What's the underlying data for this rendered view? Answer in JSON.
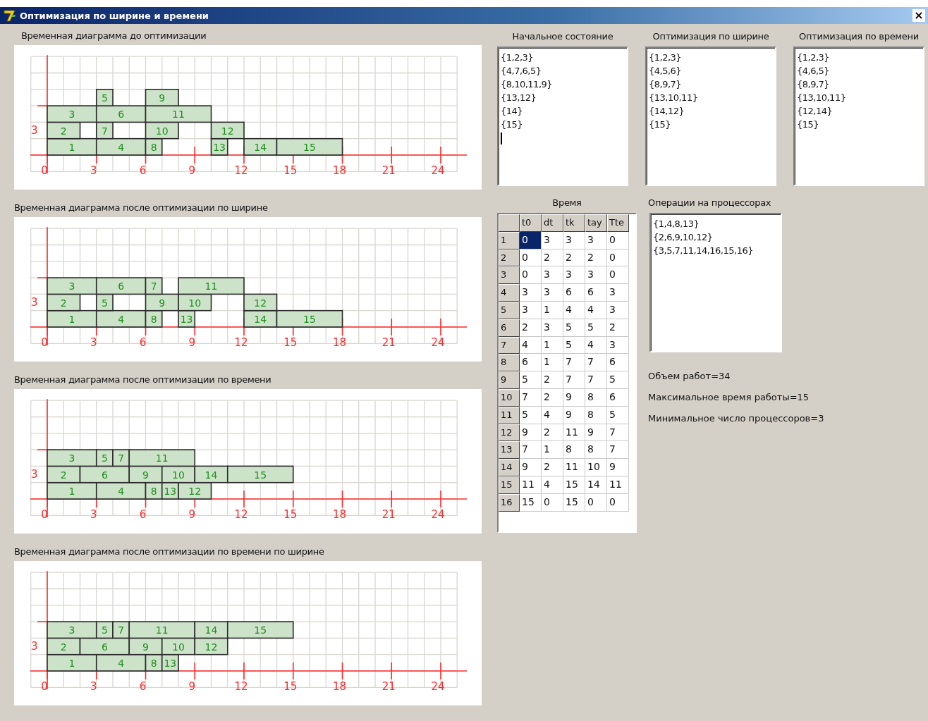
{
  "window": {
    "title": "Оптимизация по ширине и времени",
    "close": "×"
  },
  "charts": [
    {
      "title": "Временная диаграмма до оптимизации",
      "lane_label": "3",
      "time_labels": [
        "0",
        "3",
        "6",
        "9",
        "12",
        "15",
        "18",
        "21",
        "24"
      ],
      "tasks": [
        "1",
        "4",
        "8",
        "13",
        "14",
        "15",
        "2",
        "7",
        "10",
        "12",
        "3",
        "6",
        "11",
        "5",
        "9"
      ]
    },
    {
      "title": "Временная диаграмма после оптимизации по ширине",
      "lane_label": "3",
      "time_labels": [
        "0",
        "3",
        "6",
        "9",
        "12",
        "15",
        "18",
        "21",
        "24"
      ],
      "tasks": [
        "1",
        "4",
        "8",
        "13",
        "14",
        "15",
        "2",
        "5",
        "9",
        "10",
        "12",
        "3",
        "6",
        "7",
        "11"
      ]
    },
    {
      "title": "Временная диаграмма после оптимизации по времени",
      "lane_label": "3",
      "time_labels": [
        "0",
        "3",
        "6",
        "9",
        "12",
        "15",
        "18",
        "21",
        "24"
      ],
      "tasks": [
        "1",
        "4",
        "8",
        "13",
        "12",
        "2",
        "6",
        "9",
        "10",
        "14",
        "15",
        "3",
        "5",
        "7",
        "11"
      ]
    },
    {
      "title": "Временная диаграмма после оптимизации по времени по ширине",
      "lane_label": "3",
      "time_labels": [
        "0",
        "3",
        "6",
        "9",
        "12",
        "15",
        "18",
        "21",
        "24"
      ],
      "tasks": [
        "1",
        "4",
        "8",
        "13",
        "2",
        "6",
        "9",
        "10",
        "12",
        "3",
        "5",
        "7",
        "11",
        "14",
        "15"
      ]
    }
  ],
  "lists": [
    {
      "title": "Начальное состояние",
      "cursor": true,
      "lines": [
        "{1,2,3}",
        "{4,7,6,5}",
        "{8,10,11,9}",
        "{13,12}",
        "{14}",
        "{15}"
      ]
    },
    {
      "title": "Оптимизация по ширине",
      "cursor": false,
      "lines": [
        "{1,2,3}",
        "{4,5,6}",
        "{8,9,7}",
        "{13,10,11}",
        "{14,12}",
        "{15}"
      ]
    },
    {
      "title": "Оптимизация по времени",
      "cursor": false,
      "lines": [
        "{1,2,3}",
        "{4,6,5}",
        "{8,9,7}",
        "{13,10,11}",
        "{12,14}",
        "{15}"
      ]
    }
  ],
  "time_table": {
    "title": "Время",
    "columns": [
      "t0",
      "dt",
      "tk",
      "tay",
      "Tte"
    ],
    "rows": [
      {
        "header": "1",
        "cells": [
          {
            "text": "0",
            "selected": true
          },
          {
            "text": "3",
            "selected": false
          },
          {
            "text": "3",
            "selected": false
          },
          {
            "text": "3",
            "selected": false
          },
          {
            "text": "0",
            "selected": false
          }
        ]
      },
      {
        "header": "2",
        "cells": [
          {
            "text": "0",
            "selected": false
          },
          {
            "text": "2",
            "selected": false
          },
          {
            "text": "2",
            "selected": false
          },
          {
            "text": "2",
            "selected": false
          },
          {
            "text": "0",
            "selected": false
          }
        ]
      },
      {
        "header": "3",
        "cells": [
          {
            "text": "0",
            "selected": false
          },
          {
            "text": "3",
            "selected": false
          },
          {
            "text": "3",
            "selected": false
          },
          {
            "text": "3",
            "selected": false
          },
          {
            "text": "0",
            "selected": false
          }
        ]
      },
      {
        "header": "4",
        "cells": [
          {
            "text": "3",
            "selected": false
          },
          {
            "text": "3",
            "selected": false
          },
          {
            "text": "6",
            "selected": false
          },
          {
            "text": "6",
            "selected": false
          },
          {
            "text": "3",
            "selected": false
          }
        ]
      },
      {
        "header": "5",
        "cells": [
          {
            "text": "3",
            "selected": false
          },
          {
            "text": "1",
            "selected": false
          },
          {
            "text": "4",
            "selected": false
          },
          {
            "text": "4",
            "selected": false
          },
          {
            "text": "3",
            "selected": false
          }
        ]
      },
      {
        "header": "6",
        "cells": [
          {
            "text": "2",
            "selected": false
          },
          {
            "text": "3",
            "selected": false
          },
          {
            "text": "5",
            "selected": false
          },
          {
            "text": "5",
            "selected": false
          },
          {
            "text": "2",
            "selected": false
          }
        ]
      },
      {
        "header": "7",
        "cells": [
          {
            "text": "4",
            "selected": false
          },
          {
            "text": "1",
            "selected": false
          },
          {
            "text": "5",
            "selected": false
          },
          {
            "text": "4",
            "selected": false
          },
          {
            "text": "3",
            "selected": false
          }
        ]
      },
      {
        "header": "8",
        "cells": [
          {
            "text": "6",
            "selected": false
          },
          {
            "text": "1",
            "selected": false
          },
          {
            "text": "7",
            "selected": false
          },
          {
            "text": "7",
            "selected": false
          },
          {
            "text": "6",
            "selected": false
          }
        ]
      },
      {
        "header": "9",
        "cells": [
          {
            "text": "5",
            "selected": false
          },
          {
            "text": "2",
            "selected": false
          },
          {
            "text": "7",
            "selected": false
          },
          {
            "text": "7",
            "selected": false
          },
          {
            "text": "5",
            "selected": false
          }
        ]
      },
      {
        "header": "10",
        "cells": [
          {
            "text": "7",
            "selected": false
          },
          {
            "text": "2",
            "selected": false
          },
          {
            "text": "9",
            "selected": false
          },
          {
            "text": "8",
            "selected": false
          },
          {
            "text": "6",
            "selected": false
          }
        ]
      },
      {
        "header": "11",
        "cells": [
          {
            "text": "5",
            "selected": false
          },
          {
            "text": "4",
            "selected": false
          },
          {
            "text": "9",
            "selected": false
          },
          {
            "text": "8",
            "selected": false
          },
          {
            "text": "5",
            "selected": false
          }
        ]
      },
      {
        "header": "12",
        "cells": [
          {
            "text": "9",
            "selected": false
          },
          {
            "text": "2",
            "selected": false
          },
          {
            "text": "11",
            "selected": false
          },
          {
            "text": "9",
            "selected": false
          },
          {
            "text": "7",
            "selected": false
          }
        ]
      },
      {
        "header": "13",
        "cells": [
          {
            "text": "7",
            "selected": false
          },
          {
            "text": "1",
            "selected": false
          },
          {
            "text": "8",
            "selected": false
          },
          {
            "text": "8",
            "selected": false
          },
          {
            "text": "7",
            "selected": false
          }
        ]
      },
      {
        "header": "14",
        "cells": [
          {
            "text": "9",
            "selected": false
          },
          {
            "text": "2",
            "selected": false
          },
          {
            "text": "11",
            "selected": false
          },
          {
            "text": "10",
            "selected": false
          },
          {
            "text": "9",
            "selected": false
          }
        ]
      },
      {
        "header": "15",
        "cells": [
          {
            "text": "11",
            "selected": false
          },
          {
            "text": "4",
            "selected": false
          },
          {
            "text": "15",
            "selected": false
          },
          {
            "text": "14",
            "selected": false
          },
          {
            "text": "11",
            "selected": false
          }
        ]
      },
      {
        "header": "16",
        "cells": [
          {
            "text": "15",
            "selected": false
          },
          {
            "text": "0",
            "selected": false
          },
          {
            "text": "15",
            "selected": false
          },
          {
            "text": "0",
            "selected": false
          },
          {
            "text": "0",
            "selected": false
          }
        ]
      }
    ]
  },
  "processors": {
    "title": "Операции на процессорах",
    "lines": [
      "{1,4,8,13}",
      "{2,6,9,10,12}",
      "{3,5,7,11,14,16,15,16}"
    ]
  },
  "stats": [
    "Объем работ=34",
    "Максимальное время работы=15",
    "Минимальное число процессоров=3"
  ]
}
